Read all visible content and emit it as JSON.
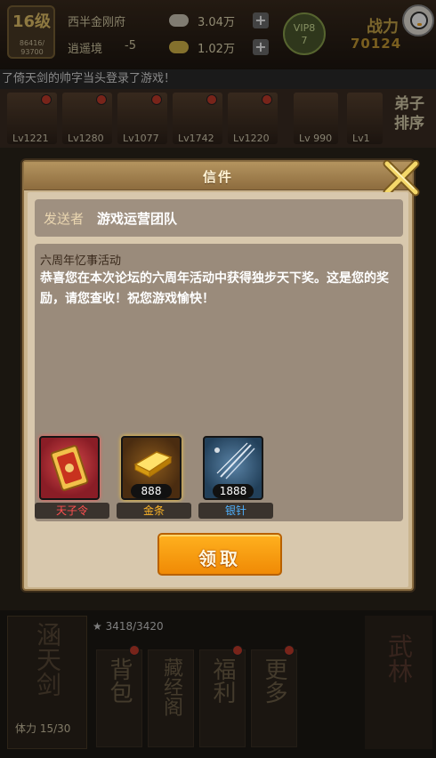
{
  "hud": {
    "level": "16级",
    "exp": "86416/\n93700",
    "sect_name": "西半金刚府",
    "rank_label": "逍遥境",
    "rank_value": "-5",
    "silver": "3.04万",
    "gold": "1.02万",
    "vip": "VIP8\n7",
    "power_label": "战力",
    "power_value": "70124"
  },
  "marquee": "了倚天剑的帅字当头登录了游戏！",
  "disciples": [
    {
      "lv": "Lv1221"
    },
    {
      "lv": "Lv1280"
    },
    {
      "lv": "Lv1077"
    },
    {
      "lv": "Lv1742"
    },
    {
      "lv": "Lv1220"
    },
    {
      "lv": "Lv 990"
    },
    {
      "lv": "Lv1"
    }
  ],
  "disciple_side": "弟子\n排序",
  "bottom": {
    "stars": "★ 3418/3420",
    "left_title": "涵天剑",
    "force": "体力 15/30",
    "menu": [
      "背包",
      "藏经阁",
      "福利",
      "更多"
    ],
    "right_title": "武林"
  },
  "dialog": {
    "title": "信件",
    "sender_label": "发送者",
    "sender_name": "游戏运营团队",
    "subject": "六周年忆事活动",
    "body": "恭喜您在本次论坛的六周年活动中获得独步天下奖。这是您的奖励，请您查收！祝您游戏愉快！",
    "claim_label": "领取",
    "rewards": [
      {
        "name": "天子令",
        "qty": "",
        "name_color": "#ff4f4f",
        "icon": "token-icon"
      },
      {
        "name": "金条",
        "qty": "888",
        "name_color": "#ffb627",
        "icon": "gold-bar-icon"
      },
      {
        "name": "银针",
        "qty": "1888",
        "name_color": "#4fb2ff",
        "icon": "silver-needle-icon"
      }
    ]
  }
}
